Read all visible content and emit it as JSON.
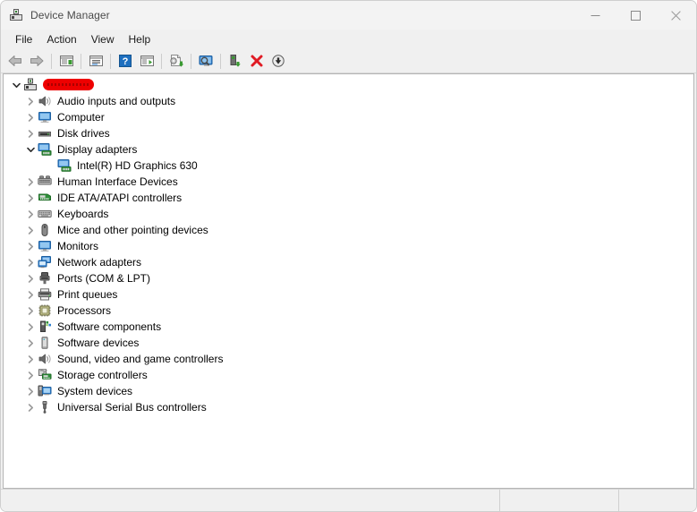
{
  "window": {
    "title": "Device Manager",
    "icon": "device-manager-icon",
    "controls": {
      "minimize": "—",
      "maximize": "□",
      "close": "✕"
    }
  },
  "menubar": {
    "items": [
      {
        "label": "File",
        "name": "menu-file"
      },
      {
        "label": "Action",
        "name": "menu-action"
      },
      {
        "label": "View",
        "name": "menu-view"
      },
      {
        "label": "Help",
        "name": "menu-help"
      }
    ]
  },
  "toolbar": {
    "buttons": [
      {
        "icon": "back-arrow-icon",
        "tooltip": "Back"
      },
      {
        "icon": "forward-arrow-icon",
        "tooltip": "Forward"
      },
      {
        "icon": "show-hide-console-tree-icon",
        "tooltip": "Show/Hide Console Tree"
      },
      {
        "icon": "properties-icon",
        "tooltip": "Properties"
      },
      {
        "icon": "help-icon",
        "tooltip": "Help"
      },
      {
        "icon": "show-hide-action-pane-icon",
        "tooltip": "Show/Hide Action Pane"
      },
      {
        "icon": "update-driver-icon",
        "tooltip": "Update driver"
      },
      {
        "icon": "scan-for-hardware-changes-icon",
        "tooltip": "Scan for hardware changes"
      },
      {
        "icon": "device-properties-icon",
        "tooltip": "Properties"
      },
      {
        "icon": "uninstall-device-icon",
        "tooltip": "Uninstall device"
      },
      {
        "icon": "enable-device-icon",
        "tooltip": "Enable device"
      }
    ]
  },
  "tree": {
    "root": {
      "label": "",
      "redacted": true,
      "icon": "computer-root-icon",
      "expanded": true,
      "chevron": "expanded"
    },
    "items": [
      {
        "label": "Audio inputs and outputs",
        "icon": "speaker-icon",
        "chevron": "collapsed",
        "level": 1
      },
      {
        "label": "Computer",
        "icon": "monitor-icon",
        "chevron": "collapsed",
        "level": 1
      },
      {
        "label": "Disk drives",
        "icon": "disk-drive-icon",
        "chevron": "collapsed",
        "level": 1
      },
      {
        "label": "Display adapters",
        "icon": "display-adapter-icon",
        "chevron": "expanded",
        "level": 1
      },
      {
        "label": "Intel(R) HD Graphics 630",
        "icon": "display-adapter-icon",
        "chevron": "none",
        "level": 2
      },
      {
        "label": "Human Interface Devices",
        "icon": "hid-icon",
        "chevron": "collapsed",
        "level": 1
      },
      {
        "label": "IDE ATA/ATAPI controllers",
        "icon": "ide-controller-icon",
        "chevron": "collapsed",
        "level": 1
      },
      {
        "label": "Keyboards",
        "icon": "keyboard-icon",
        "chevron": "collapsed",
        "level": 1
      },
      {
        "label": "Mice and other pointing devices",
        "icon": "mouse-icon",
        "chevron": "collapsed",
        "level": 1
      },
      {
        "label": "Monitors",
        "icon": "monitor-icon",
        "chevron": "collapsed",
        "level": 1
      },
      {
        "label": "Network adapters",
        "icon": "network-adapter-icon",
        "chevron": "collapsed",
        "level": 1
      },
      {
        "label": "Ports (COM & LPT)",
        "icon": "port-icon",
        "chevron": "collapsed",
        "level": 1
      },
      {
        "label": "Print queues",
        "icon": "printer-icon",
        "chevron": "collapsed",
        "level": 1
      },
      {
        "label": "Processors",
        "icon": "processor-icon",
        "chevron": "collapsed",
        "level": 1
      },
      {
        "label": "Software components",
        "icon": "software-component-icon",
        "chevron": "collapsed",
        "level": 1
      },
      {
        "label": "Software devices",
        "icon": "software-device-icon",
        "chevron": "collapsed",
        "level": 1
      },
      {
        "label": "Sound, video and game controllers",
        "icon": "speaker-icon",
        "chevron": "collapsed",
        "level": 1
      },
      {
        "label": "Storage controllers",
        "icon": "storage-controller-icon",
        "chevron": "collapsed",
        "level": 1
      },
      {
        "label": "System devices",
        "icon": "system-device-icon",
        "chevron": "collapsed",
        "level": 1
      },
      {
        "label": "Universal Serial Bus controllers",
        "icon": "usb-icon",
        "chevron": "collapsed",
        "level": 1
      }
    ]
  },
  "statusbar": {
    "panels": [
      "",
      "",
      ""
    ]
  },
  "colors": {
    "window_bg": "#f0f0f0",
    "titlebar_bg": "#f3f3f3",
    "tree_bg": "#ffffff",
    "redaction": "#ee0000",
    "accent_blue": "#1e6fbf",
    "icon_green": "#3a9a32",
    "uninstall_red": "#e01b24"
  }
}
